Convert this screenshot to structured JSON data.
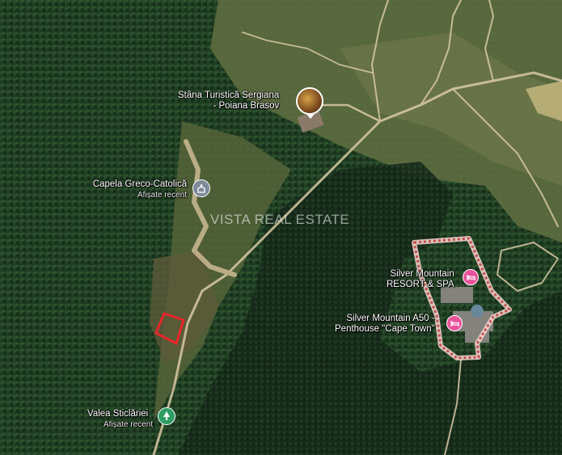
{
  "watermark": "VISTA REAL ESTATE",
  "places": {
    "stana": {
      "name_line1": "Stâna Turistică Sergiana",
      "name_line2": "- Poiana Brasov",
      "icon": "photo-thumbnail"
    },
    "capela": {
      "name": "Capela Greco-Catolică",
      "sub": "Afișate recent",
      "icon": "church-icon"
    },
    "silver_resort": {
      "name_line1": "Silver Mountain",
      "name_line2": "RESORT & SPA",
      "icon": "hotel-icon"
    },
    "silver_a50": {
      "name_line1": "Silver Mountain A50 -",
      "name_line2": "Penthouse \"Cape Town\"",
      "icon": "hotel-icon"
    },
    "valea": {
      "name": "Valea Sticlăriei",
      "sub": "Afișate recent",
      "icon": "tree-icon"
    }
  },
  "colors": {
    "forest": "#1f3d22",
    "meadow": "#5b6b3e",
    "road": "#d9c9a6",
    "plot_outline": "#e8262b",
    "resort_outline": "#f0d2cf",
    "resort_dash": "#c0524a",
    "pin_pink": "#e8539b",
    "pin_green": "#2f9e63",
    "pin_gray": "#7d8a99"
  }
}
